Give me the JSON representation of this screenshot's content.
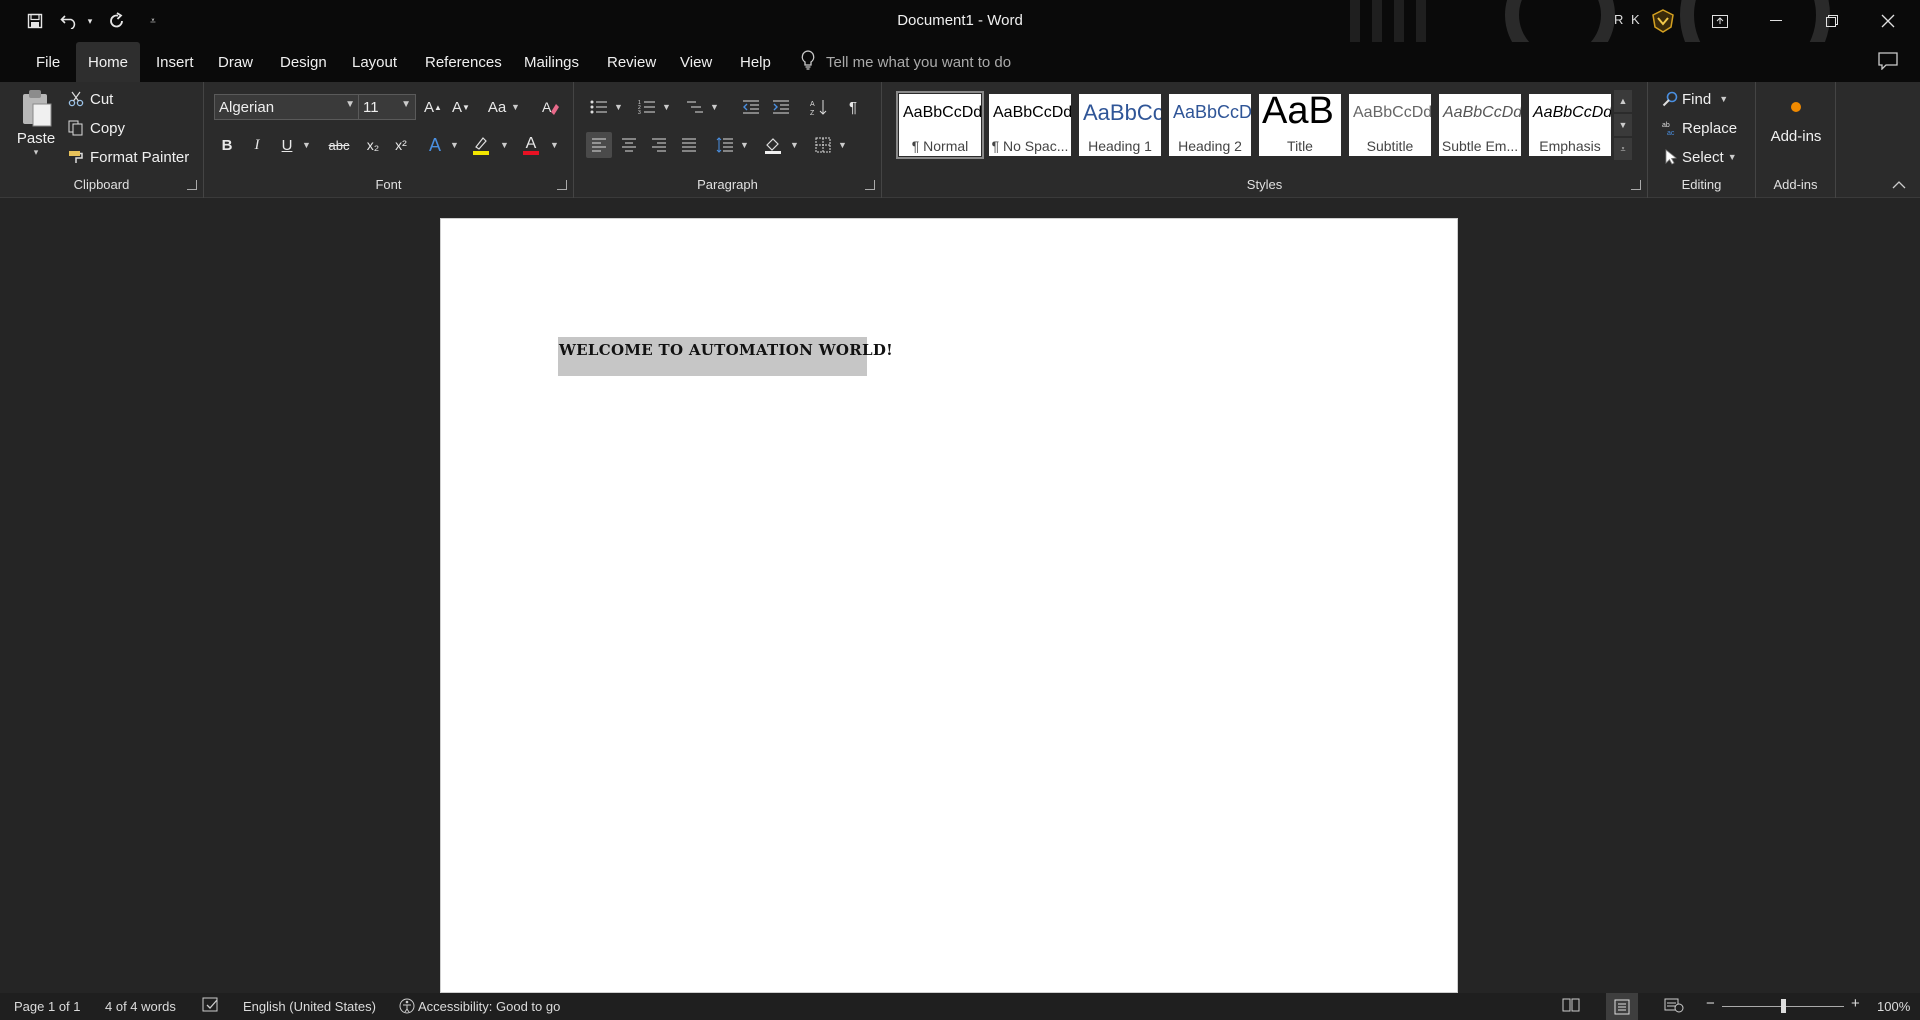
{
  "titlebar": {
    "document_title": "Document1  -  Word",
    "user_initials": "R K",
    "qat": {
      "save": "save-icon",
      "undo": "undo-icon",
      "redo": "redo-icon",
      "customize": "customize-qat-icon"
    }
  },
  "menu": {
    "tabs": [
      "File",
      "Home",
      "Insert",
      "Draw",
      "Design",
      "Layout",
      "References",
      "Mailings",
      "Review",
      "View",
      "Help"
    ],
    "active_tab": "Home",
    "tell_me_placeholder": "Tell me what you want to do"
  },
  "ribbon": {
    "clipboard": {
      "label": "Clipboard",
      "paste": "Paste",
      "cut": "Cut",
      "copy": "Copy",
      "format_painter": "Format Painter"
    },
    "font": {
      "label": "Font",
      "font_name": "Algerian",
      "font_size": "11",
      "change_case": "Aa",
      "bold": "B",
      "italic": "I",
      "underline": "U",
      "strikethrough": "abc",
      "subscript": "x₂",
      "superscript": "x²",
      "text_effects": "A",
      "font_color": "A",
      "highlight_color": "#f2e600",
      "font_color_value": "#e81123"
    },
    "paragraph": {
      "label": "Paragraph",
      "show_marks": "¶"
    },
    "styles": {
      "label": "Styles",
      "items": [
        {
          "sample": "AaBbCcDd",
          "name": "¶ Normal"
        },
        {
          "sample": "AaBbCcDd",
          "name": "¶ No Spac..."
        },
        {
          "sample": "AaBbCc",
          "name": "Heading 1"
        },
        {
          "sample": "AaBbCcD",
          "name": "Heading 2"
        },
        {
          "sample": "AaB",
          "name": "Title"
        },
        {
          "sample": "AaBbCcDd",
          "name": "Subtitle"
        },
        {
          "sample": "AaBbCcDd",
          "name": "Subtle Em..."
        },
        {
          "sample": "AaBbCcDd",
          "name": "Emphasis"
        }
      ]
    },
    "editing": {
      "label": "Editing",
      "find": "Find",
      "replace": "Replace",
      "select": "Select"
    },
    "addins": {
      "label": "Add-ins",
      "button": "Add-ins"
    }
  },
  "document": {
    "text": "WELCOME TO AUTOMATION WORLD!"
  },
  "status": {
    "page": "Page 1 of 1",
    "words": "4 of 4 words",
    "language": "English (United States)",
    "accessibility": "Accessibility: Good to go",
    "zoom": "100%",
    "zoom_level": 1.0
  }
}
